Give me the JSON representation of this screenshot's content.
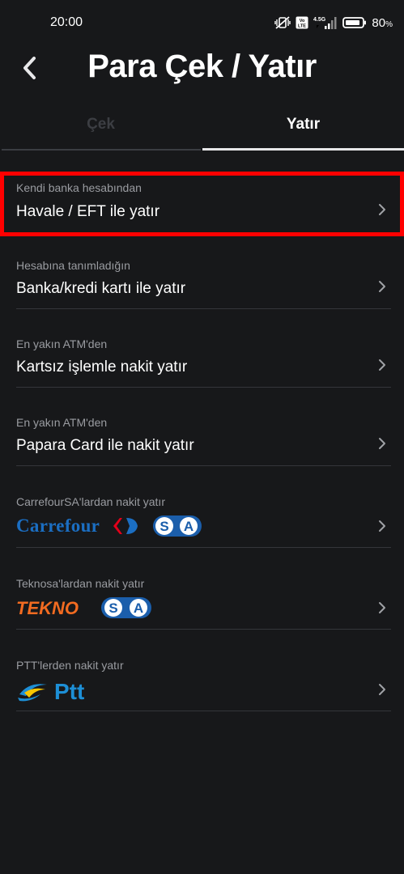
{
  "status_bar": {
    "time": "20:00",
    "network": "4.5G",
    "volte": "Vo LTE",
    "battery": "80",
    "battery_unit": "%"
  },
  "header": {
    "title": "Para Çek / Yatır"
  },
  "tabs": [
    {
      "label": "Çek",
      "active": false
    },
    {
      "label": "Yatır",
      "active": true
    }
  ],
  "options": [
    {
      "subtitle": "Kendi banka hesabından",
      "title": "Havale / EFT ile yatır",
      "highlighted": true
    },
    {
      "subtitle": "Hesabına tanımladığın",
      "title": "Banka/kredi kartı ile yatır"
    },
    {
      "subtitle": "En yakın ATM'den",
      "title": "Kartsız işlemle nakit yatır"
    },
    {
      "subtitle": "En yakın ATM'den",
      "title": "Papara Card ile nakit yatır"
    },
    {
      "subtitle": "CarrefourSA'lardan nakit yatır",
      "logo": "carrefoursa-logo",
      "logo_text": "Carrefour",
      "logo_badge": "SA"
    },
    {
      "subtitle": "Teknosa'lardan nakit yatır",
      "logo": "teknosa-logo",
      "logo_text": "TEKNO",
      "logo_badge": "SA"
    },
    {
      "subtitle": "PTT'lerden nakit yatır",
      "logo": "ptt-logo",
      "logo_text": "Ptt"
    }
  ],
  "colors": {
    "background": "#17181a",
    "highlight": "#ff0000",
    "carrefour_blue": "#1b5eab",
    "carrefour_red": "#e2001a",
    "teknosa_orange": "#f26b21",
    "ptt_blue": "#1d8fd6",
    "ptt_yellow": "#f7c600"
  }
}
